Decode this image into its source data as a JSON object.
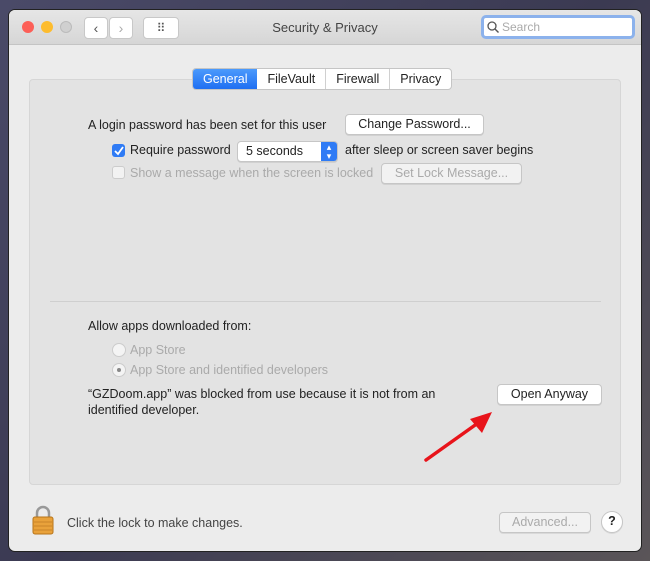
{
  "window": {
    "title": "Security & Privacy",
    "search_placeholder": "Search",
    "back": "‹",
    "forward": "›",
    "grid": "⠿"
  },
  "tabs": [
    {
      "label": "General",
      "active": true
    },
    {
      "label": "FileVault"
    },
    {
      "label": "Firewall"
    },
    {
      "label": "Privacy"
    }
  ],
  "general": {
    "login_text": "A login password has been set for this user",
    "change_password": "Change Password...",
    "require_password": "Require password",
    "require_checked": true,
    "delay": "5 seconds",
    "after_text": "after sleep or screen saver begins",
    "show_message": "Show a message when the screen is locked",
    "set_lock_message": "Set Lock Message...",
    "allow_label": "Allow apps downloaded from:",
    "radio_app_store": "App Store",
    "radio_identified": "App Store and identified developers",
    "blocked_line1": "“GZDoom.app” was blocked from use because it is not from an",
    "blocked_line2": "identified developer.",
    "open_anyway": "Open Anyway"
  },
  "footer": {
    "lock_text": "Click the lock to make changes.",
    "advanced": "Advanced...",
    "help": "?"
  },
  "colors": {
    "accent": "#1f6ff2",
    "arrow": "#e8141b"
  }
}
